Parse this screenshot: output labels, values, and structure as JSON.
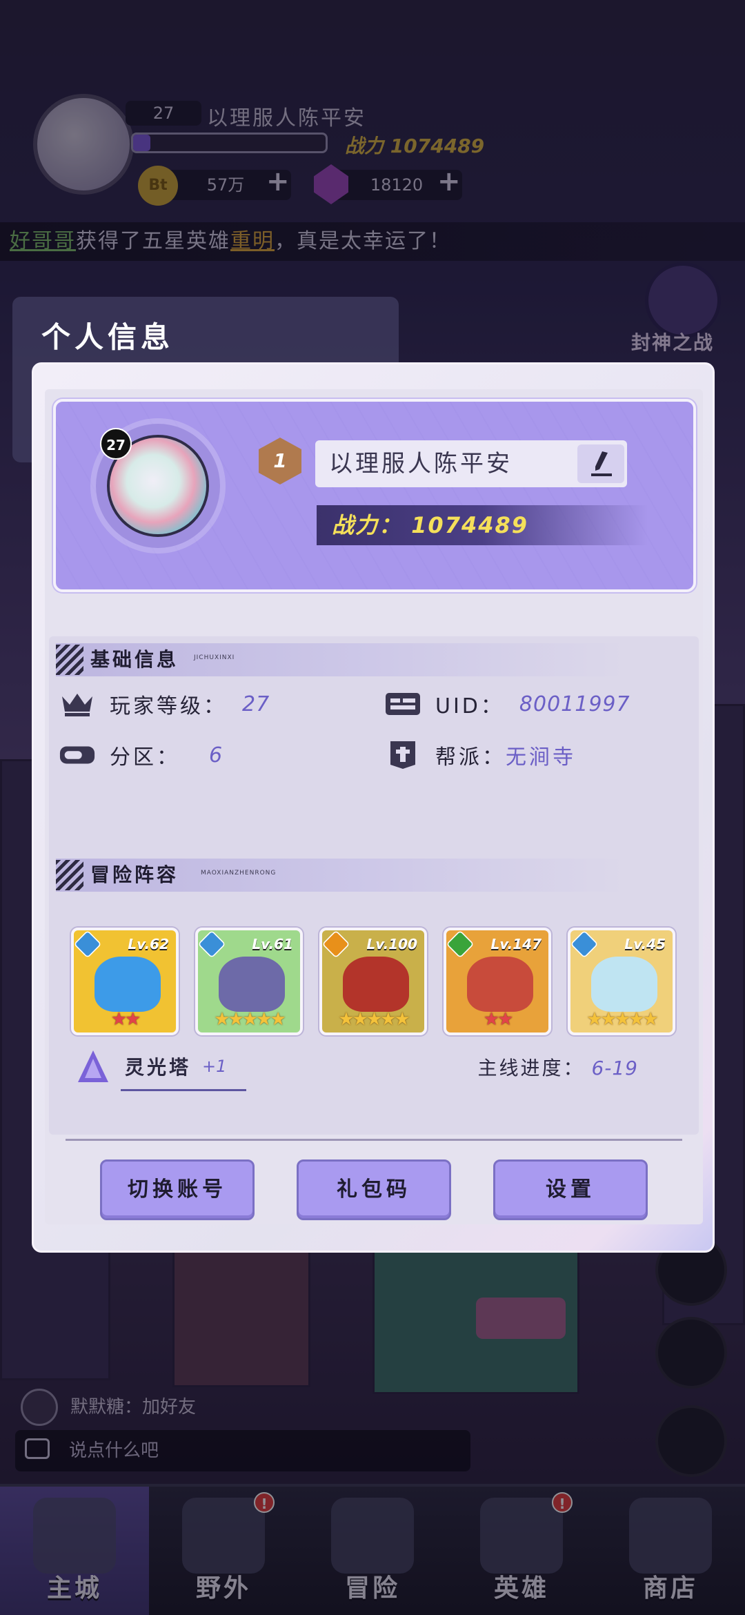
{
  "hud": {
    "level": "27",
    "name": "以理服人陈平安",
    "power_label": "战力",
    "power_value": "1074489",
    "exp_fraction": 0.09,
    "coin_label": "Bt",
    "coin_value": "57万",
    "gem_value": "18120",
    "plus": "+"
  },
  "ticker": {
    "player": "好哥哥",
    "text_1": "获得了五星英雄",
    "hero": "重明",
    "text_2": "，真是太幸运了！"
  },
  "event": {
    "label": "封神之战"
  },
  "modal": {
    "title": "个人信息",
    "avatar_level": "27",
    "rank": "1",
    "name": "以理服人陈平安",
    "power_label": "战力：",
    "power_value": "1074489",
    "basic_section": {
      "title": "基础信息",
      "subtitle": "JICHUXINXI"
    },
    "info": {
      "player_level_label": "玩家等级：",
      "player_level_value": "27",
      "uid_label": "UID：",
      "uid_value": "80011997",
      "server_label": "分区：",
      "server_value": "6",
      "guild_label": "帮派：",
      "guild_value": "无涧寺"
    },
    "lineup_section": {
      "title": "冒险阵容",
      "subtitle": "MAOXIANZHENRONG"
    },
    "heroes": [
      {
        "level": "Lv.62",
        "stars": "★★",
        "star_color": "red",
        "element": "water",
        "element_color": "#3a8fd8",
        "bg": "#f1c232",
        "face": "#3d9be8"
      },
      {
        "level": "Lv.61",
        "stars": "★★★★★",
        "star_color": "gold",
        "element": "water",
        "element_color": "#3a8fd8",
        "bg": "#9fd98c",
        "face": "#6d6aa8"
      },
      {
        "level": "Lv.100",
        "stars": "★★★★★",
        "star_color": "gold",
        "element": "fire",
        "element_color": "#e8901a",
        "bg": "#c9b04a",
        "face": "#b3342a"
      },
      {
        "level": "Lv.147",
        "stars": "★★",
        "star_color": "red",
        "element": "wood",
        "element_color": "#3aa43a",
        "bg": "#e8a23a",
        "face": "#c84b3b"
      },
      {
        "level": "Lv.45",
        "stars": "★★★★★",
        "star_color": "gold",
        "element": "water",
        "element_color": "#3a8fd8",
        "bg": "#f0d07a",
        "face": "#bfe4f2"
      }
    ],
    "tower_label": "灵光塔",
    "tower_value": "+1",
    "progress_label": "主线进度：",
    "progress_value": "6-19",
    "buttons": {
      "switch": "切换账号",
      "gift": "礼包码",
      "settings": "设置"
    }
  },
  "chat": {
    "friend_msg": "默默糖：加好友",
    "placeholder": "说点什么吧"
  },
  "nav": [
    {
      "label": "主城",
      "badge": ""
    },
    {
      "label": "野外",
      "badge": "!"
    },
    {
      "label": "冒险",
      "badge": ""
    },
    {
      "label": "英雄",
      "badge": "!"
    },
    {
      "label": "商店",
      "badge": ""
    }
  ],
  "colors": {
    "accent": "#a99af0",
    "value_text": "#6b5fc6",
    "power_text": "#f5e05a"
  }
}
